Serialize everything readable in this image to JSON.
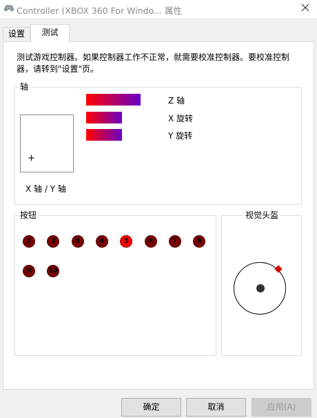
{
  "window": {
    "title": "Controller (XBOX 360 For Windo... 属性",
    "close_icon": "close-icon"
  },
  "tabs": [
    {
      "label": "设置",
      "active": false
    },
    {
      "label": "测试",
      "active": true
    }
  ],
  "description": "测试游戏控制器。如果控制器工作不正常，就需要校准控制器。要校准控制器，请转到\"设置\"页。",
  "axes_group": {
    "legend": "轴",
    "xy_label": "X 轴 / Y 轴",
    "crosshair": "+",
    "bars": [
      {
        "label": "Z 轴",
        "level": 0.88
      },
      {
        "label": "X 旋转",
        "level": 0.58
      },
      {
        "label": "Y 旋转",
        "level": 0.58
      }
    ],
    "colors": {
      "bar_start": "#ff0000",
      "bar_end": "#6a00c8"
    }
  },
  "buttons_group": {
    "legend": "按钮",
    "buttons": [
      {
        "label": "1",
        "pressed": false
      },
      {
        "label": "2",
        "pressed": false
      },
      {
        "label": "3",
        "pressed": false
      },
      {
        "label": "4",
        "pressed": false
      },
      {
        "label": "5",
        "pressed": true
      },
      {
        "label": "6",
        "pressed": false
      },
      {
        "label": "7",
        "pressed": false
      },
      {
        "label": "8",
        "pressed": false
      },
      {
        "label": "9",
        "pressed": false
      },
      {
        "label": "10",
        "pressed": false
      }
    ],
    "colors": {
      "idle": "#7a0000",
      "pressed": "#ff0000"
    }
  },
  "pov_group": {
    "legend": "视觉头盔",
    "direction": "northeast",
    "marker_color": "#d40000"
  },
  "dialog_buttons": [
    {
      "label": "确定",
      "enabled": true
    },
    {
      "label": "取消",
      "enabled": true
    },
    {
      "label": "应用(A)",
      "enabled": false
    }
  ]
}
